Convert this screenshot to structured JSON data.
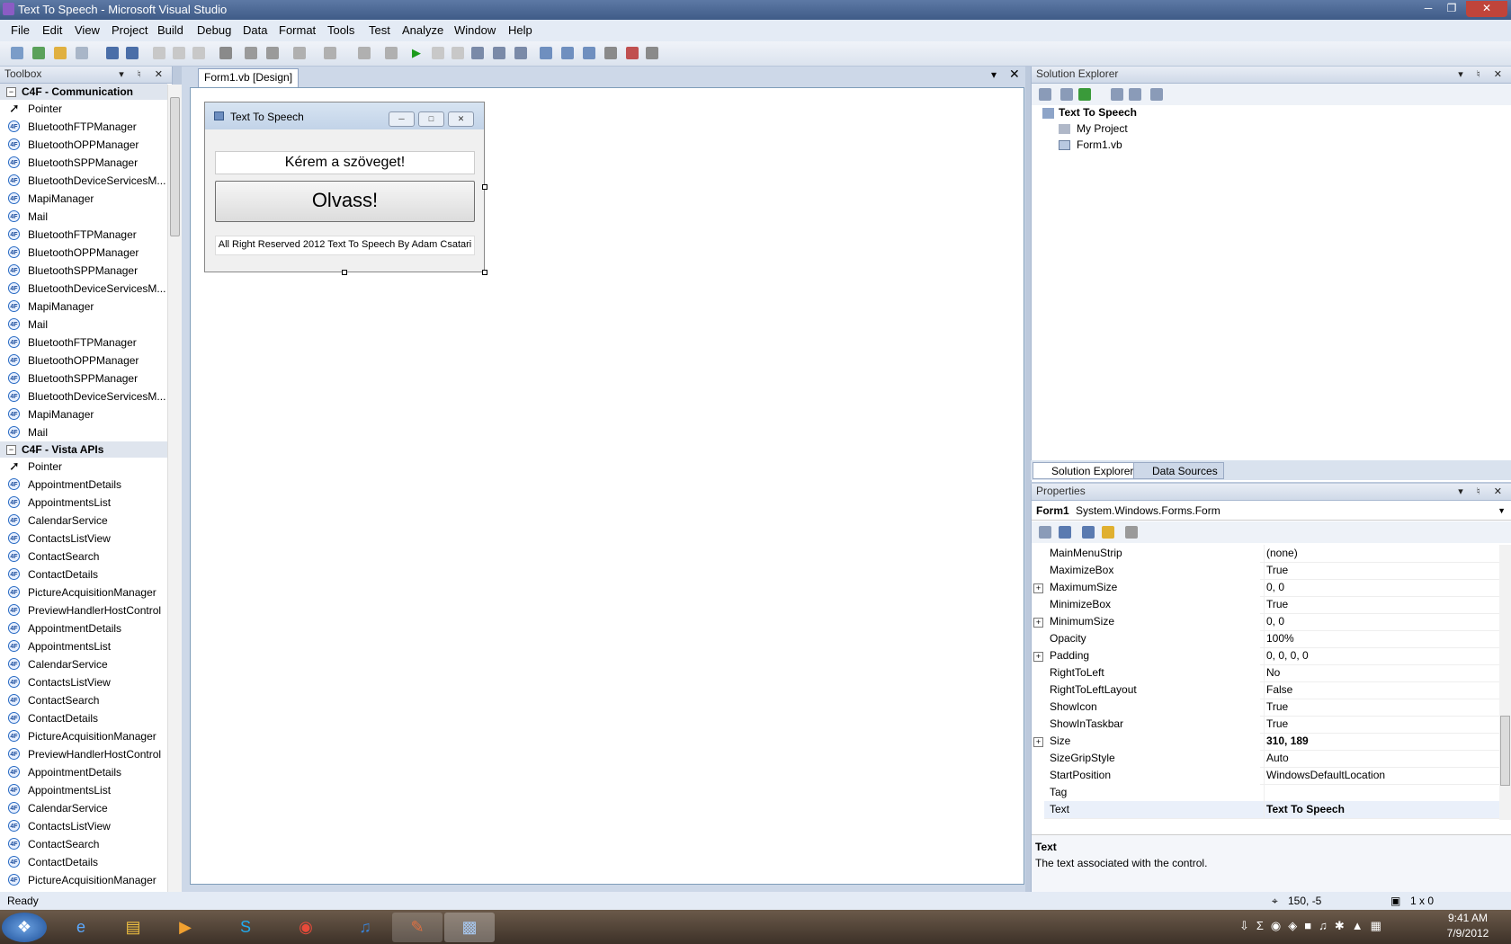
{
  "window": {
    "title": "Text To Speech - Microsoft Visual Studio"
  },
  "menu": [
    "File",
    "Edit",
    "View",
    "Project",
    "Build",
    "Debug",
    "Data",
    "Format",
    "Tools",
    "Test",
    "Analyze",
    "Window",
    "Help"
  ],
  "toolbox": {
    "title": "Toolbox",
    "cat1": "C4F - Communication",
    "cat1_items": [
      "Pointer",
      "BluetoothFTPManager",
      "BluetoothOPPManager",
      "BluetoothSPPManager",
      "BluetoothDeviceServicesM...",
      "MapiManager",
      "Mail",
      "BluetoothFTPManager",
      "BluetoothOPPManager",
      "BluetoothSPPManager",
      "BluetoothDeviceServicesM...",
      "MapiManager",
      "Mail",
      "BluetoothFTPManager",
      "BluetoothOPPManager",
      "BluetoothSPPManager",
      "BluetoothDeviceServicesM...",
      "MapiManager",
      "Mail"
    ],
    "cat2": "C4F - Vista APIs",
    "cat2_items": [
      "Pointer",
      "AppointmentDetails",
      "AppointmentsList",
      "CalendarService",
      "ContactsListView",
      "ContactSearch",
      "ContactDetails",
      "PictureAcquisitionManager",
      "PreviewHandlerHostControl",
      "AppointmentDetails",
      "AppointmentsList",
      "CalendarService",
      "ContactsListView",
      "ContactSearch",
      "ContactDetails",
      "PictureAcquisitionManager",
      "PreviewHandlerHostControl",
      "AppointmentDetails",
      "AppointmentsList",
      "CalendarService",
      "ContactsListView",
      "ContactSearch",
      "ContactDetails",
      "PictureAcquisitionManager"
    ]
  },
  "doc": {
    "tab": "Form1.vb [Design]"
  },
  "form": {
    "title": "Text To Speech",
    "label1": "Kérem a szöveget!",
    "button": "Olvass!",
    "label2": "All Right Reserved 2012 Text To Speech By Adam Csatari"
  },
  "solution": {
    "title": "Solution Explorer",
    "root": "Text To Speech",
    "items": [
      "My Project",
      "Form1.vb"
    ],
    "tab1": "Solution Explorer",
    "tab2": "Data Sources"
  },
  "properties": {
    "title": "Properties",
    "object": "Form1",
    "type": "System.Windows.Forms.Form",
    "rows": [
      {
        "name": "MainMenuStrip",
        "value": "(none)"
      },
      {
        "name": "MaximizeBox",
        "value": "True"
      },
      {
        "name": "MaximumSize",
        "value": "0, 0",
        "exp": true
      },
      {
        "name": "MinimizeBox",
        "value": "True"
      },
      {
        "name": "MinimumSize",
        "value": "0, 0",
        "exp": true
      },
      {
        "name": "Opacity",
        "value": "100%"
      },
      {
        "name": "Padding",
        "value": "0, 0, 0, 0",
        "exp": true
      },
      {
        "name": "RightToLeft",
        "value": "No"
      },
      {
        "name": "RightToLeftLayout",
        "value": "False"
      },
      {
        "name": "ShowIcon",
        "value": "True"
      },
      {
        "name": "ShowInTaskbar",
        "value": "True"
      },
      {
        "name": "Size",
        "value": "310, 189",
        "exp": true,
        "bold": true
      },
      {
        "name": "SizeGripStyle",
        "value": "Auto"
      },
      {
        "name": "StartPosition",
        "value": "WindowsDefaultLocation"
      },
      {
        "name": "Tag",
        "value": ""
      },
      {
        "name": "Text",
        "value": "Text To Speech",
        "bold": true
      }
    ],
    "desc_title": "Text",
    "desc": "The text associated with the control."
  },
  "status": {
    "text": "Ready",
    "pos": "150, -5",
    "size": "1 x 0"
  },
  "tray": {
    "time": "9:41 AM",
    "date": "7/9/2012"
  }
}
